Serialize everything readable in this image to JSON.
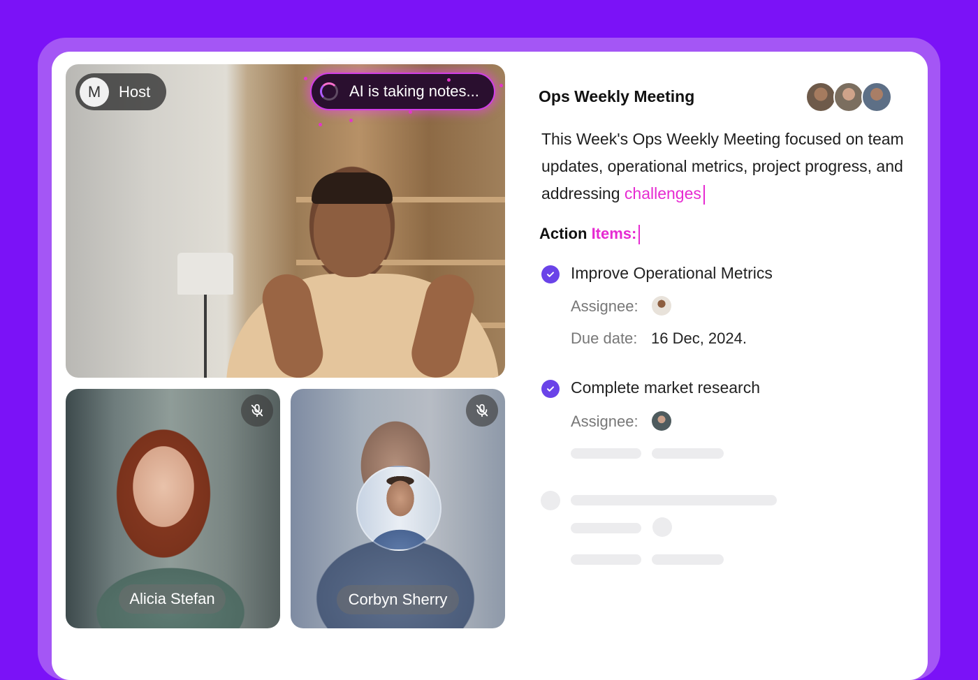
{
  "video_call": {
    "host_badge": {
      "initial": "M",
      "label": "Host"
    },
    "ai_status": "AI is taking notes...",
    "participants": [
      {
        "name": "Alicia Stefan",
        "muted": true
      },
      {
        "name": "Corbyn Sherry",
        "muted": true
      }
    ]
  },
  "notes": {
    "meeting_title": "Ops Weekly Meeting",
    "summary_text": "This Week's Ops Weekly Meeting focused on team updates, operational metrics, project progress, and addressing ",
    "summary_typing": "challenges",
    "action_items_heading_plain": "Action ",
    "action_items_heading_typing": "Items:",
    "action_items": [
      {
        "title": "Improve Operational Metrics",
        "completed": true,
        "assignee_label": "Assignee:",
        "due_label": "Due date:",
        "due_value": "16 Dec, 2024."
      },
      {
        "title": "Complete market research",
        "completed": true,
        "assignee_label": "Assignee:"
      }
    ]
  },
  "colors": {
    "background": "#7b12f7",
    "frame": "#a456f5",
    "accent_magenta": "#e62ad1",
    "check_purple": "#6a43e8"
  },
  "icons": [
    "spinner-icon",
    "mic-off-icon",
    "check-icon"
  ]
}
